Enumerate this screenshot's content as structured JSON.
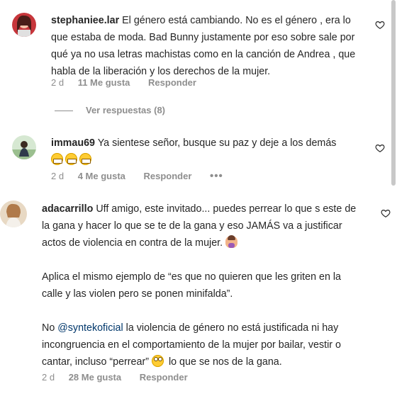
{
  "comments": [
    {
      "username": "stephaniee.lar",
      "text": "El género está cambiando. No es el género , era lo que estaba de moda. Bad Bunny justamente por eso sobre sale por qué ya no usa letras machistas como en la canción de Andrea , que habla de la liberación y los derechos de la mujer.",
      "time": "2 d",
      "likes": "11 Me gusta",
      "reply": "Responder",
      "view_replies": "Ver respuestas (8)"
    },
    {
      "username": "immau69",
      "text": "Ya sientese señor, busque su paz y deje a los demás",
      "emojis": [
        "grinning-face",
        "grinning-face",
        "grinning-face"
      ],
      "time": "2 d",
      "likes": "4 Me gusta",
      "reply": "Responder",
      "more": "•••"
    },
    {
      "username": "adacarrillo",
      "text_p1": "Uff amigo, este invitado... puedes perrear lo que s este de la gana y hacer lo que se te de la gana y eso JAMÁS va a justificar actos de violencia en contra de la mujer.",
      "text_p2": "Aplica el mismo ejemplo de “es que no quieren que les griten en la calle y las violen pero se ponen minifalda”.",
      "text_p3_a": "No",
      "mention": "@syntekoficial",
      "text_p3_b": "la violencia de género no está justificada ni hay incongruencia en el comportamiento de la mujer por bailar, vestir o cantar, incluso “perrear”",
      "text_p3_c": "lo que se nos de la gana.",
      "emoji_p1": "woman-facepalming",
      "emoji_p3": "face-with-rolling-eyes",
      "time": "2 d",
      "likes": "28 Me gusta",
      "reply": "Responder"
    }
  ],
  "icons": {
    "like": "heart-icon"
  }
}
